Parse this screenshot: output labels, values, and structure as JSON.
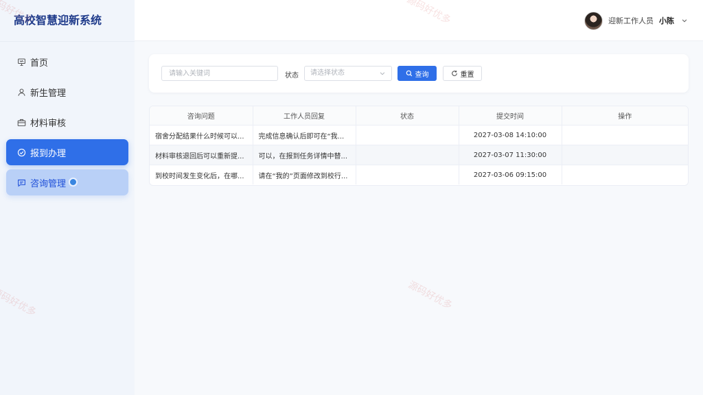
{
  "app": {
    "title": "高校智慧迎新系统"
  },
  "sidebar": {
    "items": [
      {
        "label": "首页",
        "icon": "presentation-board-icon",
        "state": "normal"
      },
      {
        "label": "新生管理",
        "icon": "user-icon",
        "state": "normal"
      },
      {
        "label": "材料审核",
        "icon": "briefcase-icon",
        "state": "normal"
      },
      {
        "label": "报到办理",
        "icon": "check-circle-icon",
        "state": "active"
      },
      {
        "label": "咨询管理",
        "icon": "chat-bubble-icon",
        "state": "hover"
      }
    ]
  },
  "header": {
    "user_role": "迎新工作人员",
    "user_name": "小陈"
  },
  "filter": {
    "keyword_placeholder": "请输入关键词",
    "keyword_value": "",
    "state_label": "状态",
    "state_placeholder": "请选择状态",
    "query_label": "查询",
    "reset_label": "重置"
  },
  "table": {
    "columns": [
      "咨询问题",
      "工作人员回复",
      "状态",
      "提交时间",
      "操作"
    ],
    "rows": [
      {
        "question": "宿舍分配结果什么时候可以...",
        "reply": "完成信息确认后即可在“我...",
        "status": "",
        "time": "2027-03-08 14:10:00",
        "action": ""
      },
      {
        "question": "材料审核退回后可以重新提...",
        "reply": "可以，在报到任务详情中替...",
        "status": "",
        "time": "2027-03-07 11:30:00",
        "action": ""
      },
      {
        "question": "到校时间发生变化后，在哪...",
        "reply": "请在“我的”页面修改到校行...",
        "status": "",
        "time": "2027-03-06 09:15:00",
        "action": ""
      }
    ]
  },
  "watermark": {
    "text": "源码好优多"
  },
  "colors": {
    "primary": "#2f6fe8",
    "brand_text": "#1e3a8a",
    "sidebar_bg": "#f1f5fb",
    "hover_bg": "#b9d0f7"
  }
}
